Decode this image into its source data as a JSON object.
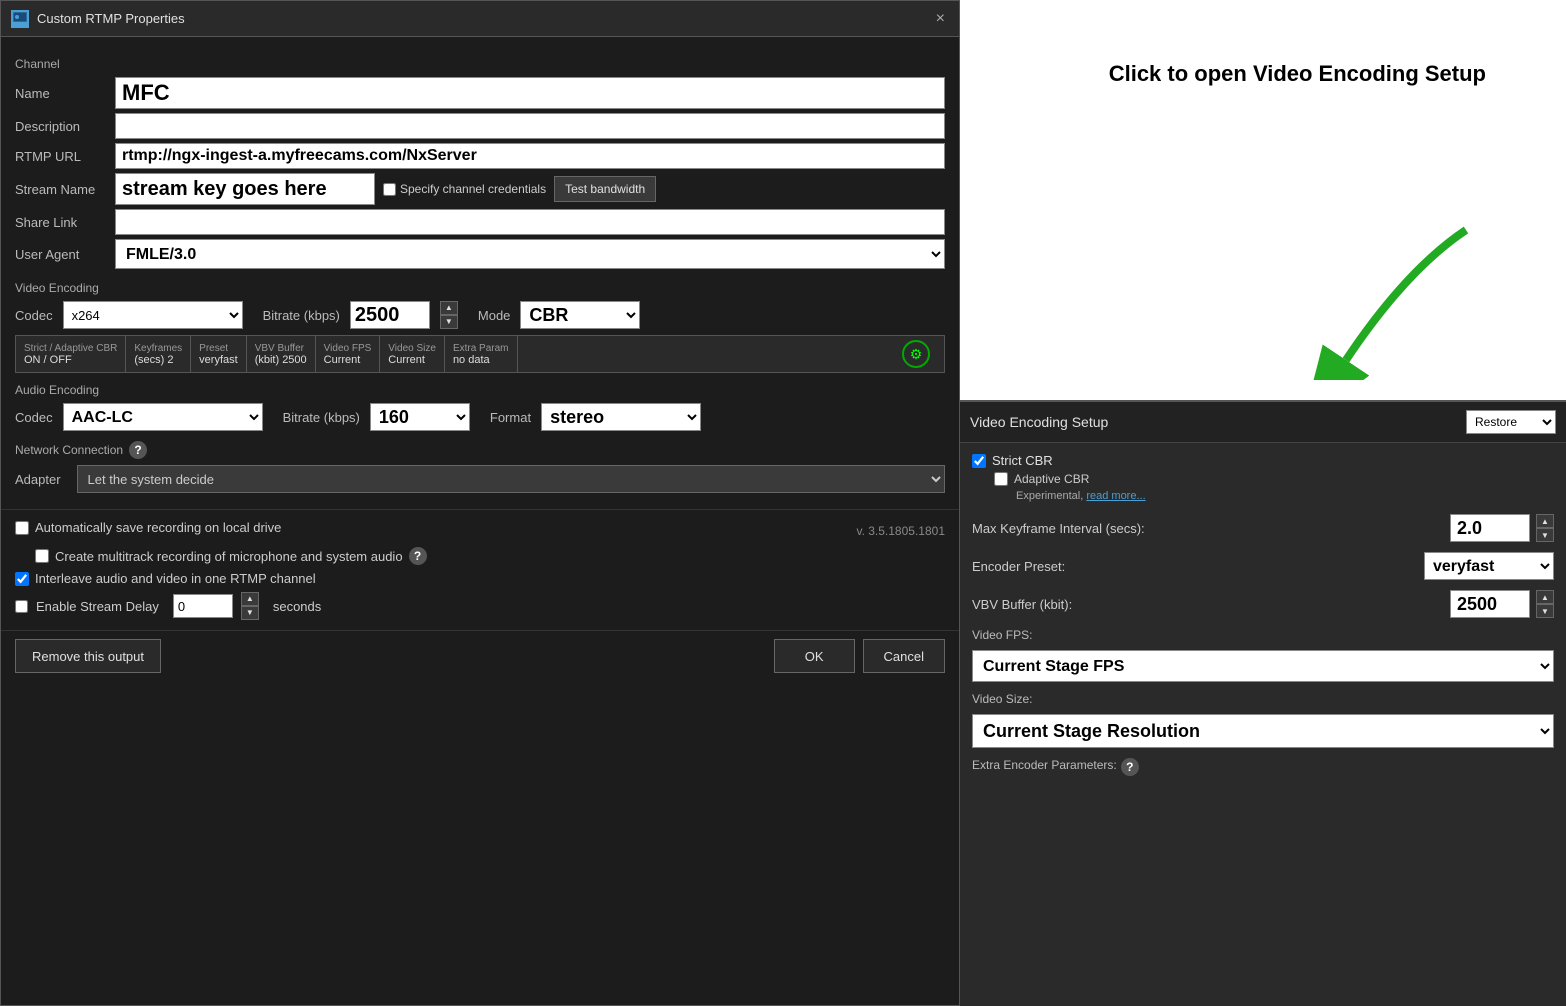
{
  "titleBar": {
    "title": "Custom RTMP Properties",
    "closeBtn": "×"
  },
  "channel": {
    "sectionLabel": "Channel",
    "fields": {
      "name": {
        "label": "Name",
        "value": "MFC"
      },
      "description": {
        "label": "Description",
        "value": ""
      },
      "rtmpUrl": {
        "label": "RTMP URL",
        "value": "rtmp://ngx-ingest-a.myfreecams.com/NxServer"
      },
      "streamName": {
        "label": "Stream Name",
        "keyValue": "stream key goes here",
        "checkboxLabel": "Specify channel credentials",
        "testBandwidthLabel": "Test bandwidth"
      },
      "shareLink": {
        "label": "Share Link",
        "value": ""
      },
      "userAgent": {
        "label": "User Agent",
        "value": "FMLE/3.0"
      }
    }
  },
  "videoEncoding": {
    "sectionLabel": "Video Encoding",
    "codec": {
      "label": "Codec",
      "value": "x264"
    },
    "bitrate": {
      "label": "Bitrate (kbps)",
      "value": "2500"
    },
    "mode": {
      "label": "Mode",
      "value": "CBR"
    },
    "details": {
      "strictAdaptive": {
        "label": "Strict / Adaptive CBR",
        "sub": "ON / OFF"
      },
      "keyframes": {
        "label": "Keyframes",
        "sub": "(secs) 2"
      },
      "preset": {
        "label": "Preset",
        "sub": "veryfast"
      },
      "vbv": {
        "label": "VBV Buffer",
        "sub": "(kbit) 2500"
      },
      "fps": {
        "label": "Video FPS",
        "sub": "Current"
      },
      "size": {
        "label": "Video Size",
        "sub": "Current"
      },
      "extra": {
        "label": "Extra Param",
        "sub": "no data"
      }
    }
  },
  "audioEncoding": {
    "sectionLabel": "Audio Encoding",
    "codec": {
      "label": "Codec",
      "value": "AAC-LC"
    },
    "bitrate": {
      "label": "Bitrate (kbps)",
      "value": "160"
    },
    "format": {
      "label": "Format",
      "value": "stereo"
    }
  },
  "network": {
    "sectionLabel": "Network Connection",
    "adapterLabel": "Adapter",
    "adapterValue": "Let the system decide"
  },
  "bottomOptions": {
    "autoSave": {
      "label": "Automatically save recording on local drive",
      "checked": false
    },
    "version": "v. 3.5.1805.1801",
    "multitrack": {
      "label": "Create multitrack recording of microphone and system audio",
      "checked": false
    },
    "interleave": {
      "label": "Interleave audio and video in one RTMP channel",
      "checked": true
    },
    "streamDelay": {
      "label": "Enable Stream Delay",
      "checked": false,
      "value": "0",
      "unit": "seconds"
    }
  },
  "dialogButtons": {
    "remove": "Remove this output",
    "ok": "OK",
    "cancel": "Cancel"
  },
  "annotation": {
    "text": "Click to open\nVideo Encoding Setup"
  },
  "veSetup": {
    "title": "Video Encoding Setup",
    "restoreLabel": "Restore",
    "strictCbr": {
      "label": "Strict CBR",
      "checked": true
    },
    "adaptiveCbr": {
      "label": "Adaptive CBR",
      "checked": false
    },
    "experimental": "Experimental,",
    "readMore": "read more...",
    "maxKeyframeLabel": "Max Keyframe Interval (secs):",
    "maxKeyframeValue": "2.0",
    "encoderPresetLabel": "Encoder Preset:",
    "encoderPresetValue": "veryfast",
    "vbvLabel": "VBV Buffer (kbit):",
    "vbvValue": "2500",
    "videoFpsLabel": "Video FPS:",
    "videoFpsValue": "Current Stage FPS",
    "videoSizeLabel": "Video Size:",
    "videoSizeValue": "Current Stage Resolution",
    "extraParamsLabel": "Extra Encoder Parameters:"
  }
}
